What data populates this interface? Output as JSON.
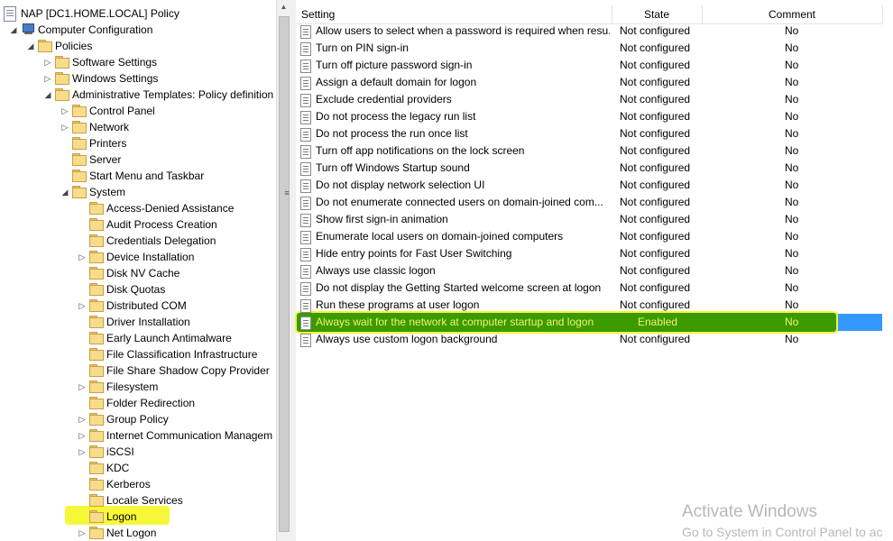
{
  "tree": {
    "items": [
      {
        "label": "NAP [DC1.HOME.LOCAL] Policy",
        "depth": 0,
        "expander": "",
        "icon": "policy-doc-icon"
      },
      {
        "label": "Computer Configuration",
        "depth": 1,
        "expander": "◢",
        "icon": "computer-icon"
      },
      {
        "label": "Policies",
        "depth": 2,
        "expander": "◢",
        "icon": "folder-icon"
      },
      {
        "label": "Software Settings",
        "depth": 3,
        "expander": "▷",
        "icon": "folder-icon"
      },
      {
        "label": "Windows Settings",
        "depth": 3,
        "expander": "▷",
        "icon": "folder-icon"
      },
      {
        "label": "Administrative Templates: Policy definition",
        "depth": 3,
        "expander": "◢",
        "icon": "folder-icon"
      },
      {
        "label": "Control Panel",
        "depth": 4,
        "expander": "▷",
        "icon": "folder-icon"
      },
      {
        "label": "Network",
        "depth": 4,
        "expander": "▷",
        "icon": "folder-icon"
      },
      {
        "label": "Printers",
        "depth": 4,
        "expander": "",
        "icon": "folder-icon"
      },
      {
        "label": "Server",
        "depth": 4,
        "expander": "",
        "icon": "folder-icon"
      },
      {
        "label": "Start Menu and Taskbar",
        "depth": 4,
        "expander": "",
        "icon": "folder-icon"
      },
      {
        "label": "System",
        "depth": 4,
        "expander": "◢",
        "icon": "folder-icon"
      },
      {
        "label": "Access-Denied Assistance",
        "depth": 5,
        "expander": "",
        "icon": "folder-icon"
      },
      {
        "label": "Audit Process Creation",
        "depth": 5,
        "expander": "",
        "icon": "folder-icon"
      },
      {
        "label": "Credentials Delegation",
        "depth": 5,
        "expander": "",
        "icon": "folder-icon"
      },
      {
        "label": "Device Installation",
        "depth": 5,
        "expander": "▷",
        "icon": "folder-icon"
      },
      {
        "label": "Disk NV Cache",
        "depth": 5,
        "expander": "",
        "icon": "folder-icon"
      },
      {
        "label": "Disk Quotas",
        "depth": 5,
        "expander": "",
        "icon": "folder-icon"
      },
      {
        "label": "Distributed COM",
        "depth": 5,
        "expander": "▷",
        "icon": "folder-icon"
      },
      {
        "label": "Driver Installation",
        "depth": 5,
        "expander": "",
        "icon": "folder-icon"
      },
      {
        "label": "Early Launch Antimalware",
        "depth": 5,
        "expander": "",
        "icon": "folder-icon"
      },
      {
        "label": "File Classification Infrastructure",
        "depth": 5,
        "expander": "",
        "icon": "folder-icon"
      },
      {
        "label": "File Share Shadow Copy Provider",
        "depth": 5,
        "expander": "",
        "icon": "folder-icon"
      },
      {
        "label": "Filesystem",
        "depth": 5,
        "expander": "▷",
        "icon": "folder-icon"
      },
      {
        "label": "Folder Redirection",
        "depth": 5,
        "expander": "",
        "icon": "folder-icon"
      },
      {
        "label": "Group Policy",
        "depth": 5,
        "expander": "▷",
        "icon": "folder-icon"
      },
      {
        "label": "Internet Communication Managem",
        "depth": 5,
        "expander": "▷",
        "icon": "folder-icon"
      },
      {
        "label": "iSCSI",
        "depth": 5,
        "expander": "▷",
        "icon": "folder-icon"
      },
      {
        "label": "KDC",
        "depth": 5,
        "expander": "",
        "icon": "folder-icon"
      },
      {
        "label": "Kerberos",
        "depth": 5,
        "expander": "",
        "icon": "folder-icon"
      },
      {
        "label": "Locale Services",
        "depth": 5,
        "expander": "",
        "icon": "folder-icon"
      },
      {
        "label": "Logon",
        "depth": 5,
        "expander": "",
        "icon": "folder-icon",
        "highlighted": true
      },
      {
        "label": "Net Logon",
        "depth": 5,
        "expander": "▷",
        "icon": "folder-icon"
      }
    ]
  },
  "list": {
    "columns": {
      "setting": "Setting",
      "state": "State",
      "comment": "Comment"
    },
    "rows": [
      {
        "setting": "Allow users to select when a password is required when resu...",
        "state": "Not configured",
        "comment": "No"
      },
      {
        "setting": "Turn on PIN sign-in",
        "state": "Not configured",
        "comment": "No"
      },
      {
        "setting": "Turn off picture password sign-in",
        "state": "Not configured",
        "comment": "No"
      },
      {
        "setting": "Assign a default domain for logon",
        "state": "Not configured",
        "comment": "No"
      },
      {
        "setting": "Exclude credential providers",
        "state": "Not configured",
        "comment": "No"
      },
      {
        "setting": "Do not process the legacy run list",
        "state": "Not configured",
        "comment": "No"
      },
      {
        "setting": "Do not process the run once list",
        "state": "Not configured",
        "comment": "No"
      },
      {
        "setting": "Turn off app notifications on the lock screen",
        "state": "Not configured",
        "comment": "No"
      },
      {
        "setting": "Turn off Windows Startup sound",
        "state": "Not configured",
        "comment": "No"
      },
      {
        "setting": "Do not display network selection UI",
        "state": "Not configured",
        "comment": "No"
      },
      {
        "setting": "Do not enumerate connected users on domain-joined com...",
        "state": "Not configured",
        "comment": "No"
      },
      {
        "setting": "Show first sign-in animation",
        "state": "Not configured",
        "comment": "No"
      },
      {
        "setting": "Enumerate local users on domain-joined computers",
        "state": "Not configured",
        "comment": "No"
      },
      {
        "setting": "Hide entry points for Fast User Switching",
        "state": "Not configured",
        "comment": "No"
      },
      {
        "setting": "Always use classic logon",
        "state": "Not configured",
        "comment": "No"
      },
      {
        "setting": "Do not display the Getting Started welcome screen at logon",
        "state": "Not configured",
        "comment": "No"
      },
      {
        "setting": "Run these programs at user logon",
        "state": "Not configured",
        "comment": "No"
      },
      {
        "setting": "Always wait for the network at computer startup and logon",
        "state": "Enabled",
        "comment": "No",
        "selected": true
      },
      {
        "setting": "Always use custom logon background",
        "state": "Not configured",
        "comment": "No"
      }
    ]
  },
  "watermark": {
    "line1": "Activate Windows",
    "line2": "Go to System in Control Panel to ac"
  },
  "colors": {
    "selection_blue": "#3399ff",
    "highlight_green": "#3a9a00",
    "highlight_yellow": "#f4f43a"
  }
}
